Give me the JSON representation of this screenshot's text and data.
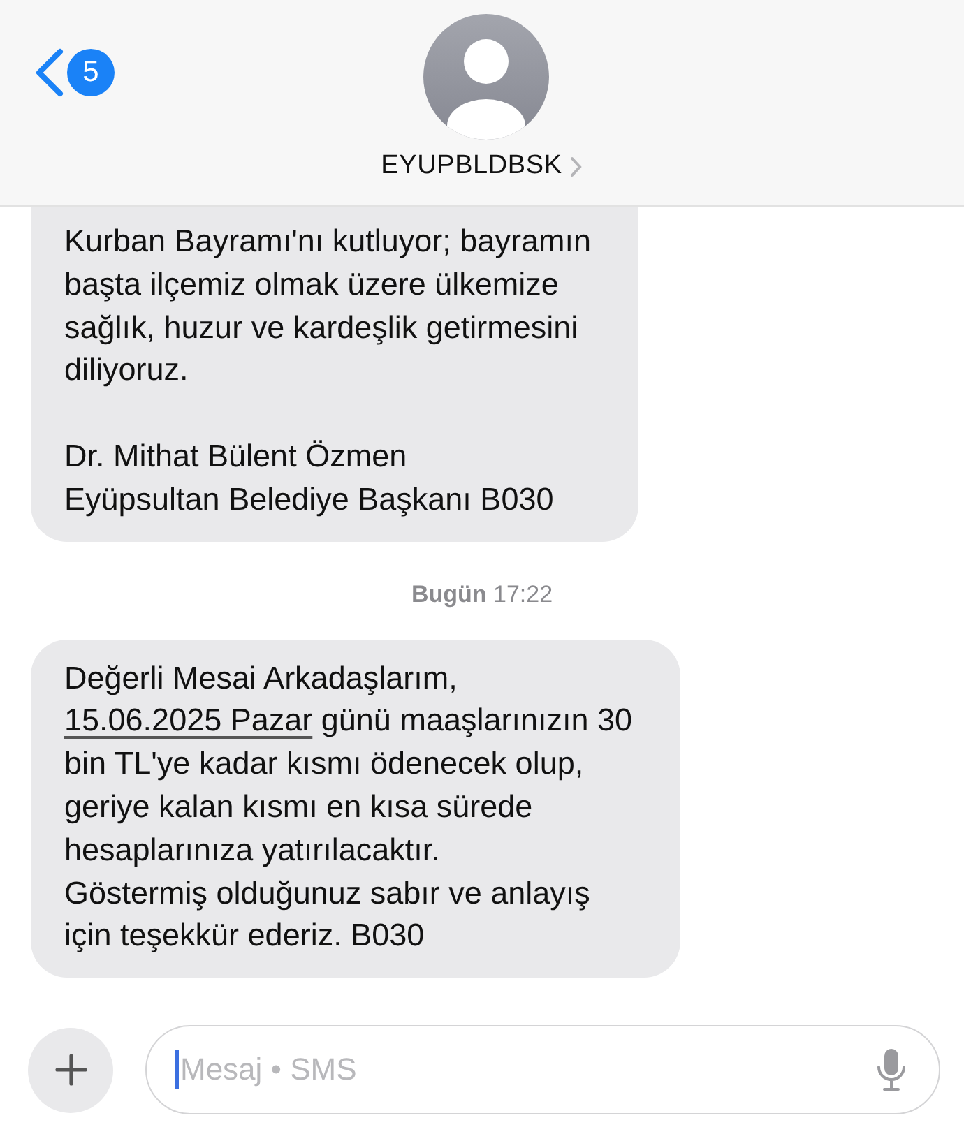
{
  "header": {
    "back_badge": "5",
    "contact_name": "EYUPBLDBSK"
  },
  "messages": [
    {
      "kind": "message",
      "top_cut": true,
      "parts": [
        {
          "kind": "text",
          "text": "Kurban Bayramı'nı kutluyor; bayramın\nbaşta ilçemiz olmak üzere ülkemize\nsağlık, huzur ve kardeşlik getirmesini\ndiliyoruz.\n\nDr. Mithat Bülent Özmen\nEyüpsultan Belediye Başkanı B030"
        }
      ]
    },
    {
      "kind": "timestamp",
      "text": "**Bugün** 17:22"
    },
    {
      "kind": "message",
      "top_cut": false,
      "parts": [
        {
          "kind": "text",
          "text": "Değerli Mesai Arkadaşlarım,\n"
        },
        {
          "kind": "link",
          "text": "15.06.2025 Pazar"
        },
        {
          "kind": "text",
          "text": " günü maaşlarınızın 30\nbin TL'ye kadar kısmı ödenecek olup,\ngeriye kalan kısmı en kısa sürede\nhesaplarınıza yatırılacaktır.\nGöstermiş olduğunuz sabır ve anlayış\niçin teşekkür ederiz. B030"
        }
      ]
    }
  ],
  "composer": {
    "placeholder": "Mesaj • SMS"
  }
}
